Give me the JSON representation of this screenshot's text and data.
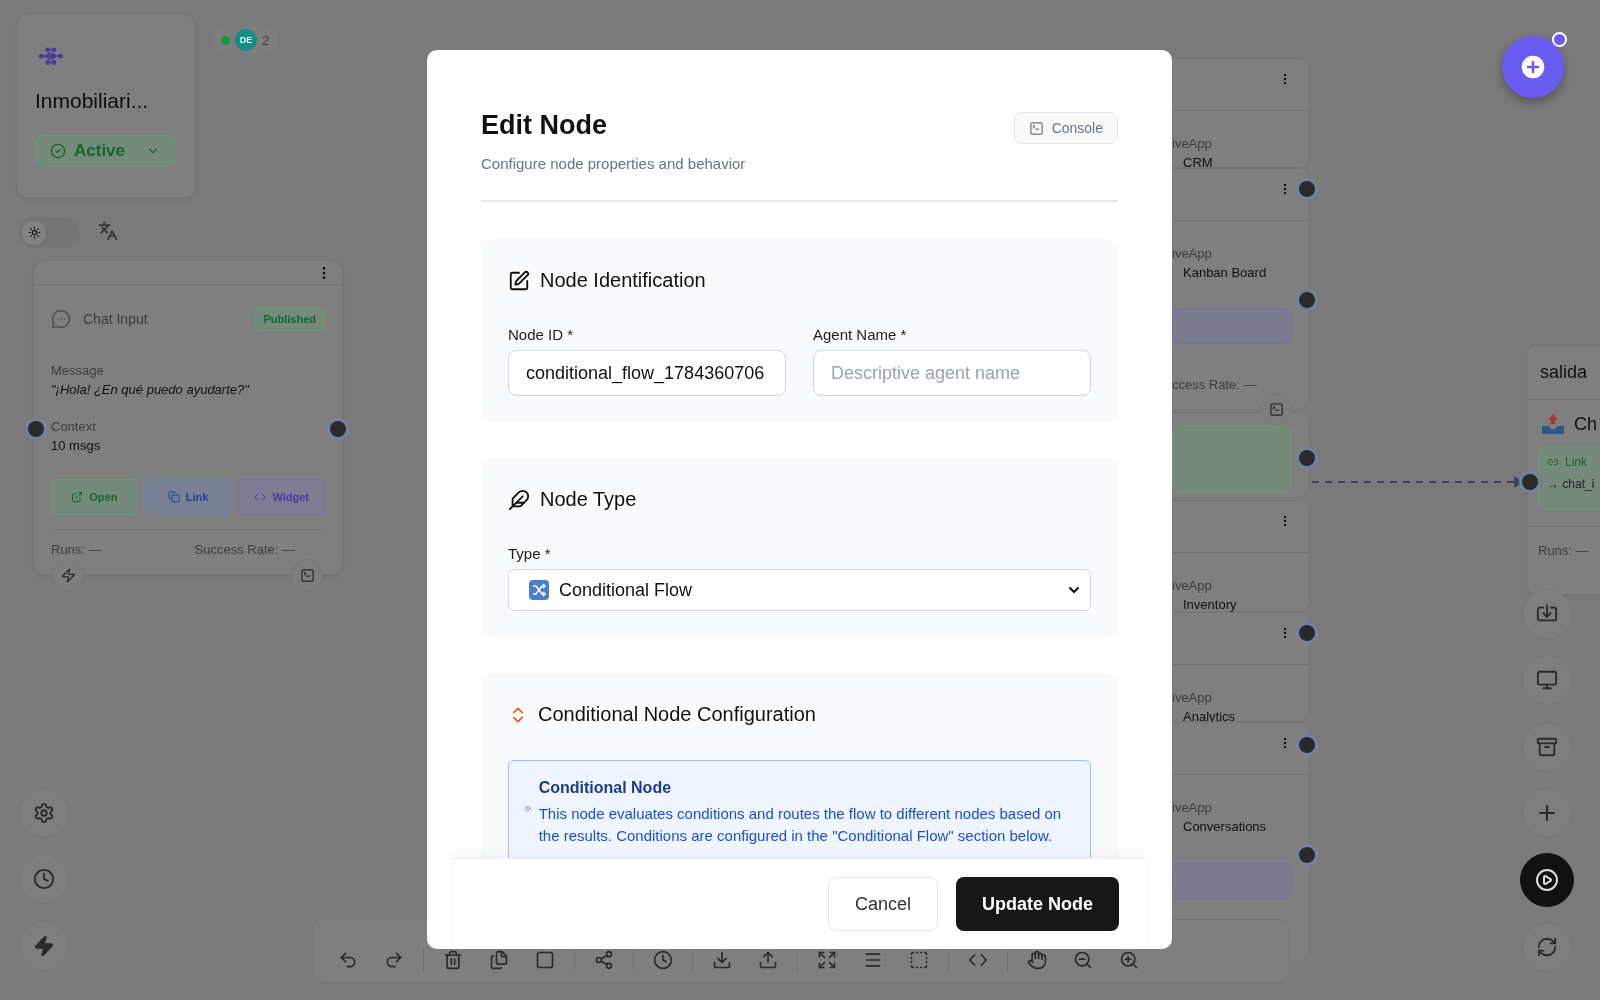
{
  "workspace": {
    "title": "Inmobiliari...",
    "status": "Active"
  },
  "theme_toggle": {
    "on": false
  },
  "presence": {
    "initials": "DE",
    "count": "2"
  },
  "chat_node": {
    "title": "Chat Input",
    "badge": "Published",
    "message_label": "Message",
    "message": "\"¡Hola! ¿En qué puedo ayudarte?\"",
    "context_label": "Context",
    "context_value": "10 msgs",
    "actions": [
      {
        "kind": "open",
        "label": "Open"
      },
      {
        "kind": "link",
        "label": "Link"
      },
      {
        "kind": "widget",
        "label": "Widget"
      }
    ],
    "runs": "Runs: —",
    "success_rate": "Success Rate: —"
  },
  "background_nodes": [
    {
      "type_label": "iveApp",
      "name": "CRM"
    },
    {
      "type_label": "iveApp",
      "name": "Kanban Board",
      "footer": "ccess Rate: —"
    },
    {
      "type_label": "iveApp",
      "name": "Inventory"
    },
    {
      "type_label": "iveApp",
      "name": "Analytics"
    },
    {
      "type_label": "iveApp",
      "name": "Conversations"
    }
  ],
  "output_node": {
    "title": "salida",
    "name": "Ch",
    "link": "Link",
    "target": "→ chat_i",
    "runs": "Runs: —"
  },
  "modal": {
    "title": "Edit Node",
    "subtitle": "Configure node properties and behavior",
    "console_button": "Console",
    "sections": [
      {
        "kind": "identification",
        "title": "Node Identification",
        "fields": [
          {
            "label": "Node ID *",
            "value": "conditional_flow_1784360706"
          },
          {
            "label": "Agent Name *",
            "placeholder": "Descriptive agent name"
          }
        ]
      },
      {
        "kind": "type",
        "title": "Node Type",
        "label": "Type *",
        "value": "Conditional Flow"
      },
      {
        "kind": "conditional",
        "title": "Conditional Node Configuration",
        "info_title": "Conditional Node",
        "info_text": "This node evaluates conditions and routes the flow to different nodes based on the results. Conditions are configured in the \"Conditional Flow\" section below."
      }
    ],
    "cancel": "Cancel",
    "submit": "Update Node"
  }
}
